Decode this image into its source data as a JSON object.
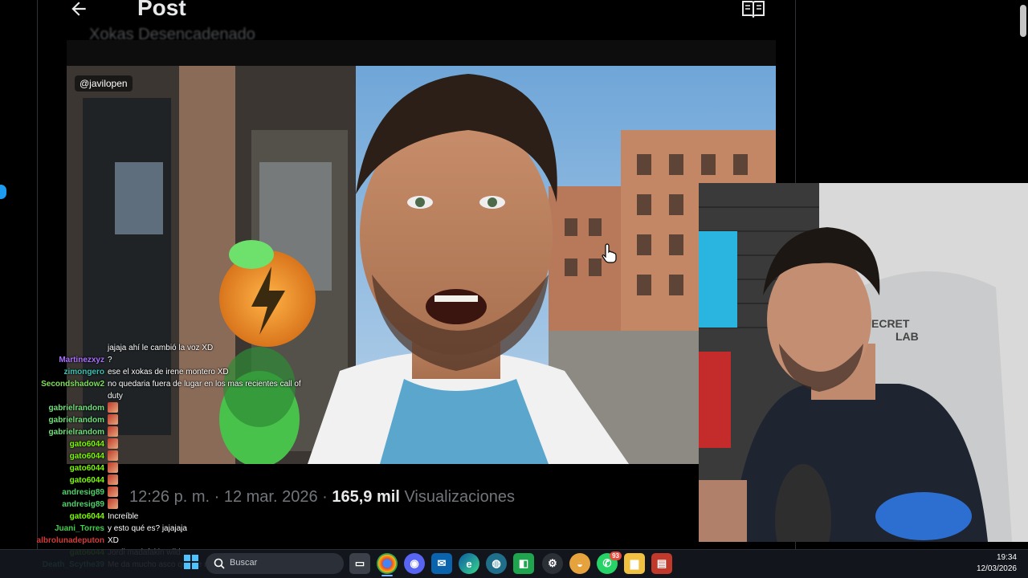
{
  "post": {
    "title": "Post",
    "text_peek": "Xokas Desencadenado",
    "watermark": "@javilopen",
    "time": "12:26 p. m.",
    "date": "12 mar. 2026",
    "views_count": "165,9 mil",
    "views_label": "Visualizaciones"
  },
  "chat": [
    {
      "user": "",
      "color": "#d23b3b",
      "msg": "jajaja ahí le cambió la voz XD"
    },
    {
      "user": "Martinezxyz",
      "color": "#a970ff",
      "msg": "?"
    },
    {
      "user": "zimongero",
      "color": "#3fc1b0",
      "msg": "ese el xokas de irene montero XD"
    },
    {
      "user": "Secondshadow2",
      "color": "#7ee05a",
      "msg": "no quedaria fuera de lugar en los mas recientes call of"
    },
    {
      "user": "",
      "color": "#7ee05a",
      "msg": "duty"
    },
    {
      "user": "gabrielrandom",
      "color": "#6fe07a",
      "msg": ""
    },
    {
      "user": "gabrielrandom",
      "color": "#6fe07a",
      "msg": ""
    },
    {
      "user": "gabrielrandom",
      "color": "#6fe07a",
      "msg": ""
    },
    {
      "user": "gato6044",
      "color": "#7cfc00",
      "msg": ""
    },
    {
      "user": "gato6044",
      "color": "#7cfc00",
      "msg": ""
    },
    {
      "user": "gato6044",
      "color": "#7cfc00",
      "msg": ""
    },
    {
      "user": "gato6044",
      "color": "#7cfc00",
      "msg": ""
    },
    {
      "user": "andresig89",
      "color": "#4fd26b",
      "msg": ""
    },
    {
      "user": "andresig89",
      "color": "#4fd26b",
      "msg": ""
    },
    {
      "user": "gato6044",
      "color": "#7cfc00",
      "msg": "Increíble"
    },
    {
      "user": "Juani_Torres",
      "color": "#3fd04a",
      "msg": "y esto qué es? jajajaja"
    },
    {
      "user": "albrolunadeputon",
      "color": "#d23b3b",
      "msg": "XD"
    },
    {
      "user": "gato6044",
      "color": "#7cfc00",
      "msg": "Jordi madafakin wild"
    },
    {
      "user": "Death_Scythe39",
      "color": "#4fe0c0",
      "msg": "Me da mucho asco que se note tanto que es ia"
    }
  ],
  "taskbar": {
    "search_label": "Buscar",
    "time": "19:34",
    "date": "12/03/2026",
    "whatsapp_badge": "93"
  },
  "colors": {
    "accent": "#1d9bf0",
    "background": "#000000",
    "muted_text": "#71767b"
  }
}
